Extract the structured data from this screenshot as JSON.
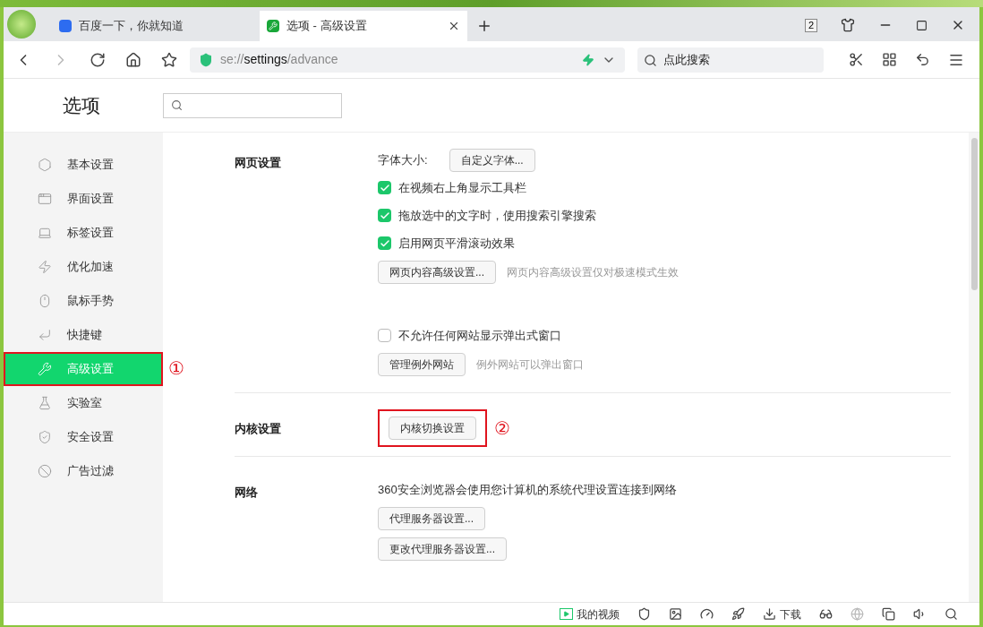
{
  "tabs": [
    {
      "title": "百度一下，你就知道",
      "selected": false,
      "kind": "baidu"
    },
    {
      "title": "选项 - 高级设置",
      "selected": true,
      "kind": "settings"
    }
  ],
  "window_count": "2",
  "address": {
    "parts": [
      {
        "text": "se://",
        "strong": false
      },
      {
        "text": "settings",
        "strong": true
      },
      {
        "text": "/advance",
        "strong": false
      }
    ]
  },
  "search": {
    "placeholder": "点此搜索"
  },
  "page": {
    "title": "选项"
  },
  "sidebar": {
    "items": [
      {
        "label": "基本设置",
        "selected": false
      },
      {
        "label": "界面设置",
        "selected": false
      },
      {
        "label": "标签设置",
        "selected": false
      },
      {
        "label": "优化加速",
        "selected": false
      },
      {
        "label": "鼠标手势",
        "selected": false
      },
      {
        "label": "快捷键",
        "selected": false
      },
      {
        "label": "高级设置",
        "selected": true,
        "annotation": "①"
      },
      {
        "label": "实验室",
        "selected": false
      },
      {
        "label": "安全设置",
        "selected": false
      },
      {
        "label": "广告过滤",
        "selected": false
      }
    ]
  },
  "sections": [
    {
      "title": "网页设置",
      "rows": [
        {
          "kind": "label_button",
          "label": "字体大小:",
          "button": "自定义字体..."
        },
        {
          "kind": "checkbox",
          "label": "在视频右上角显示工具栏",
          "checked": true
        },
        {
          "kind": "checkbox",
          "label": "拖放选中的文字时，使用搜索引擎搜索",
          "checked": true
        },
        {
          "kind": "checkbox",
          "label": "启用网页平滑滚动效果",
          "checked": true
        },
        {
          "kind": "button",
          "button": "网页内容高级设置...",
          "note": "网页内容高级设置仅对极速模式生效"
        },
        {
          "kind": "spacer"
        },
        {
          "kind": "checkbox",
          "label": "不允许任何网站显示弹出式窗口",
          "checked": false
        },
        {
          "kind": "button",
          "button": "管理例外网站",
          "note": "例外网站可以弹出窗口"
        }
      ]
    },
    {
      "title": "内核设置",
      "rows": [
        {
          "kind": "button",
          "button": "内核切换设置",
          "annotation": "②"
        }
      ]
    },
    {
      "title": "网络",
      "rows": [
        {
          "kind": "text",
          "label": "360安全浏览器会使用您计算机的系统代理设置连接到网络"
        },
        {
          "kind": "button",
          "button": "代理服务器设置..."
        },
        {
          "kind": "button",
          "button": "更改代理服务器设置..."
        }
      ]
    }
  ],
  "status_bar": {
    "video": "我的视频",
    "download": "下载"
  }
}
